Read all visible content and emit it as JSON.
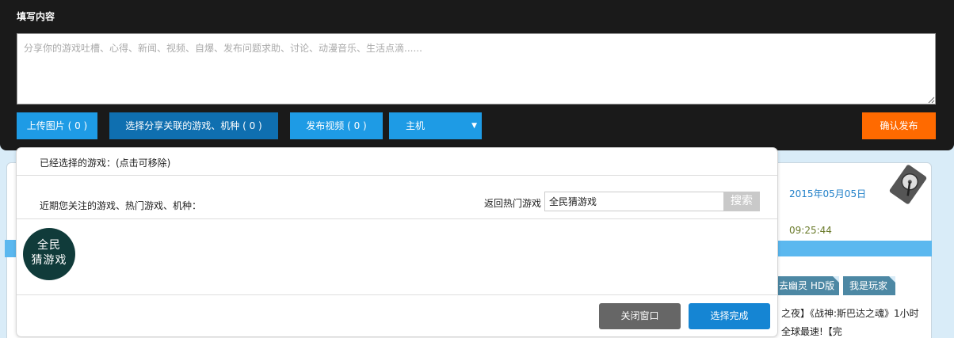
{
  "editor": {
    "title": "填写内容",
    "placeholder": "分享你的游戏吐槽、心得、新闻、视频、自爆、发布问题求助、讨论、动漫音乐、生活点滴......",
    "value": "",
    "buttons": {
      "upload_image": "上传图片 ( 0 )",
      "choose_game": "选择分享关联的游戏、机种 ( 0 )",
      "post_video": "发布视频 ( 0 )",
      "publish": "确认发布"
    },
    "console_select": {
      "selected": "主机"
    }
  },
  "modal": {
    "selected_title": "已经选择的游戏：(点击可移除)",
    "recent_title": "近期您关注的游戏、热门游戏、机种：",
    "back_hot_label": "返回热门游戏",
    "search_value": "全民猜游戏",
    "search_button": "搜索",
    "game": {
      "logo_line1": "全民",
      "logo_line2": "猜游戏"
    },
    "close_button": "关闭窗口",
    "done_button": "选择完成"
  },
  "background": {
    "date": "2015年05月05日",
    "time": "09:25:44",
    "tags": [
      "去幽灵 HD版",
      "我是玩家"
    ],
    "news_line1": "之夜】《战神:斯巴达之魂》1小时",
    "news_line2": "全球最速!【完"
  },
  "colors": {
    "editor_bg": "#1a1a1a",
    "primary_blue": "#1e9be5",
    "dark_blue": "#0f6fb0",
    "publish_orange": "#ff6a00",
    "close_gray": "#666666",
    "done_blue": "#1585d3",
    "logo_green": "#103b3a"
  }
}
